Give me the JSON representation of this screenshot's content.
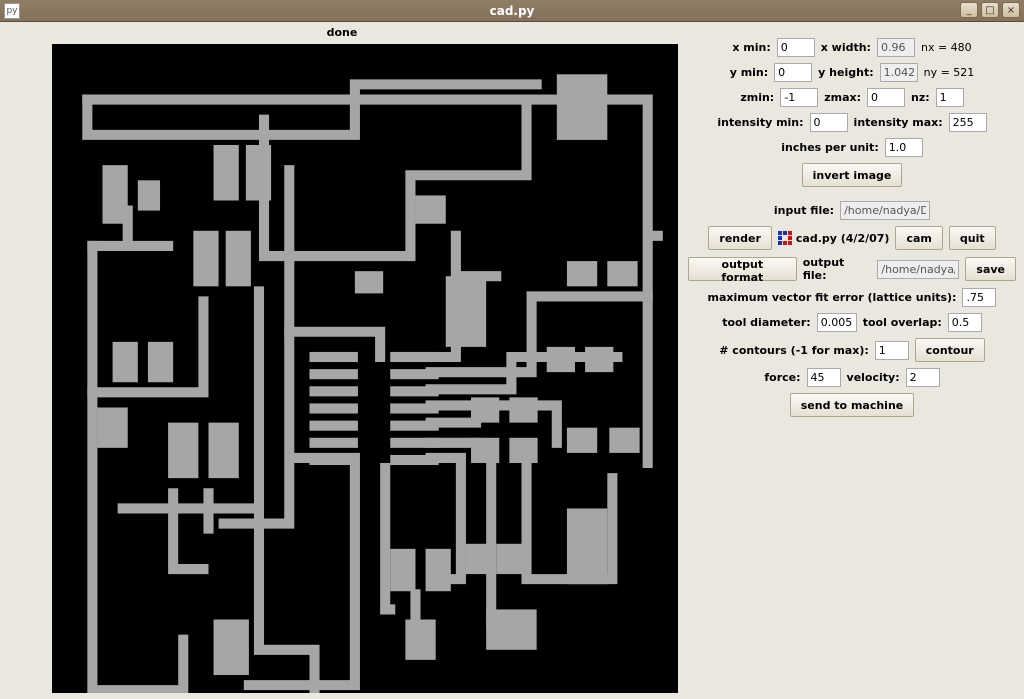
{
  "window": {
    "title": "cad.py",
    "minimize_icon": "_",
    "maximize_icon": "□",
    "close_icon": "×"
  },
  "status": "done",
  "params": {
    "xmin_label": "x min:",
    "xmin": "0",
    "xwidth_label": "x width:",
    "xwidth": "0.96",
    "nx_label": "nx = 480",
    "ymin_label": "y min:",
    "ymin": "0",
    "yheight_label": "y height:",
    "yheight": "1.042",
    "ny_label": "ny = 521",
    "zmin_label": "zmin:",
    "zmin": "-1",
    "zmax_label": "zmax:",
    "zmax": "0",
    "nz_label": "nz:",
    "nz": "1",
    "imin_label": "intensity min:",
    "imin": "0",
    "imax_label": "intensity max:",
    "imax": "255",
    "ipu_label": "inches per unit:",
    "ipu": "1.0"
  },
  "buttons": {
    "invert": "invert image",
    "render": "render",
    "cam": "cam",
    "quit": "quit",
    "output_format": "output format",
    "save": "save",
    "contour": "contour",
    "send": "send to machine"
  },
  "files": {
    "input_label": "input file:",
    "input": "/home/nadya/D",
    "output_label": "output file:",
    "output": "/home/nadya/D"
  },
  "app_version": "cad.py (4/2/07)",
  "cam": {
    "maxerr_label": "maximum vector fit error (lattice units):",
    "maxerr": ".75",
    "tooldia_label": "tool diameter:",
    "tooldia": "0.005",
    "overlap_label": "tool overlap:",
    "overlap": "0.5",
    "contours_label": "# contours (-1 for max):",
    "contours": "1",
    "force_label": "force:",
    "force": "45",
    "velocity_label": "velocity:",
    "velocity": "2"
  }
}
